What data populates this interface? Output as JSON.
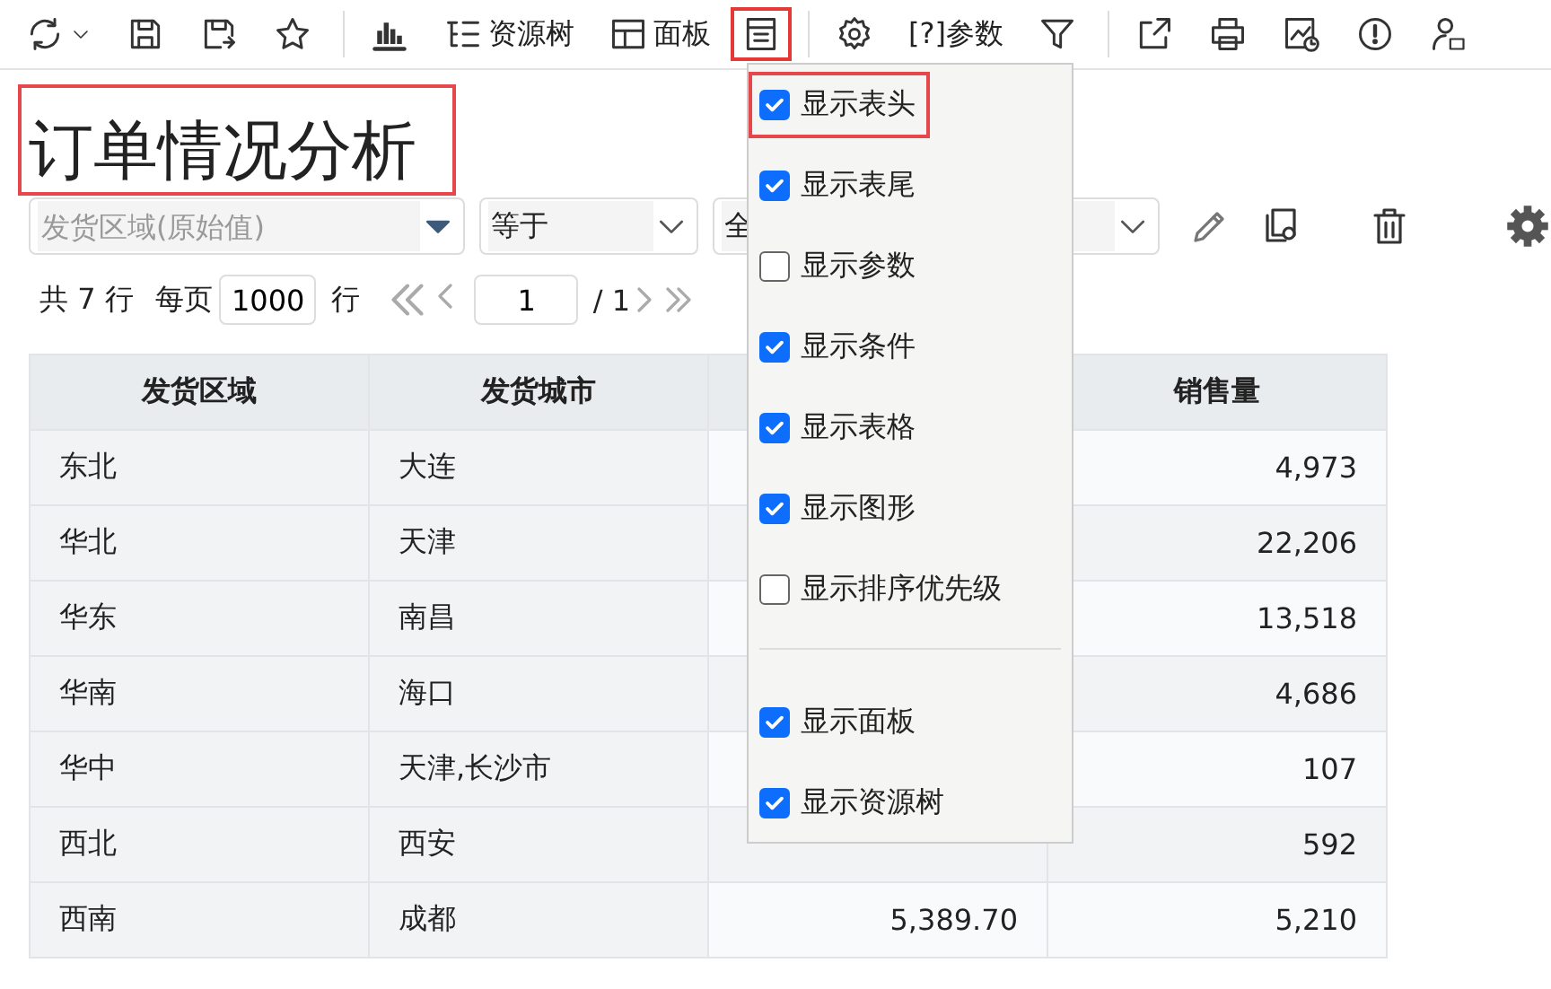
{
  "toolbar": [
    {
      "highlighted": false
    },
    {
      "highlighted": false
    },
    {
      "highlighted": false
    },
    {
      "highlighted": false
    },
    {
      "highlighted": false
    },
    {
      "label": "资源树",
      "highlighted": false
    },
    {
      "label": "面板",
      "highlighted": false
    },
    {
      "highlighted": true
    },
    {
      "highlighted": false
    },
    {
      "label": "[?]参数",
      "highlighted": false
    },
    {
      "highlighted": false
    },
    {
      "highlighted": false
    },
    {
      "highlighted": false
    },
    {
      "highlighted": false
    },
    {
      "highlighted": false
    },
    {
      "highlighted": false
    }
  ],
  "title": {
    "text": "订单情况分析",
    "highlighted": true
  },
  "filter": {
    "field": {
      "placeholder": "发货区域(原始值)"
    },
    "operator": {
      "value": "等于"
    },
    "value": {
      "value": "全"
    }
  },
  "pager": {
    "total": "共 7 行",
    "per_page_label": "每页",
    "per_page": "1000",
    "per_page_unit": "行",
    "page": "1",
    "pages": "/ 1"
  },
  "table": {
    "columns": [
      "发货区域",
      "发货城市",
      null,
      "销售量"
    ],
    "rows": [
      [
        "东北",
        "大连",
        null,
        "4,973"
      ],
      [
        "华北",
        "天津",
        null,
        "22,206"
      ],
      [
        "华东",
        "南昌",
        null,
        "13,518"
      ],
      [
        "华南",
        "海口",
        null,
        "4,686"
      ],
      [
        "华中",
        "天津,长沙市",
        null,
        "107"
      ],
      [
        "西北",
        "西安",
        null,
        "592"
      ],
      [
        "西南",
        "成都",
        "5,389.70",
        "5,210"
      ]
    ]
  },
  "menu": [
    {
      "kind": "checkbox",
      "label": "显示表头",
      "checked": true,
      "highlighted": true
    },
    {
      "kind": "checkbox",
      "label": "显示表尾",
      "checked": true,
      "highlighted": false
    },
    {
      "kind": "checkbox",
      "label": "显示参数",
      "checked": false,
      "highlighted": false
    },
    {
      "kind": "checkbox",
      "label": "显示条件",
      "checked": true,
      "highlighted": false
    },
    {
      "kind": "checkbox",
      "label": "显示表格",
      "checked": true,
      "highlighted": false
    },
    {
      "kind": "checkbox",
      "label": "显示图形",
      "checked": true,
      "highlighted": false
    },
    {
      "kind": "checkbox",
      "label": "显示排序优先级",
      "checked": false,
      "highlighted": false
    },
    {
      "kind": "separator"
    },
    {
      "kind": "checkbox",
      "label": "显示面板",
      "checked": true,
      "highlighted": false
    },
    {
      "kind": "checkbox",
      "label": "显示资源树",
      "checked": true,
      "highlighted": false
    }
  ]
}
